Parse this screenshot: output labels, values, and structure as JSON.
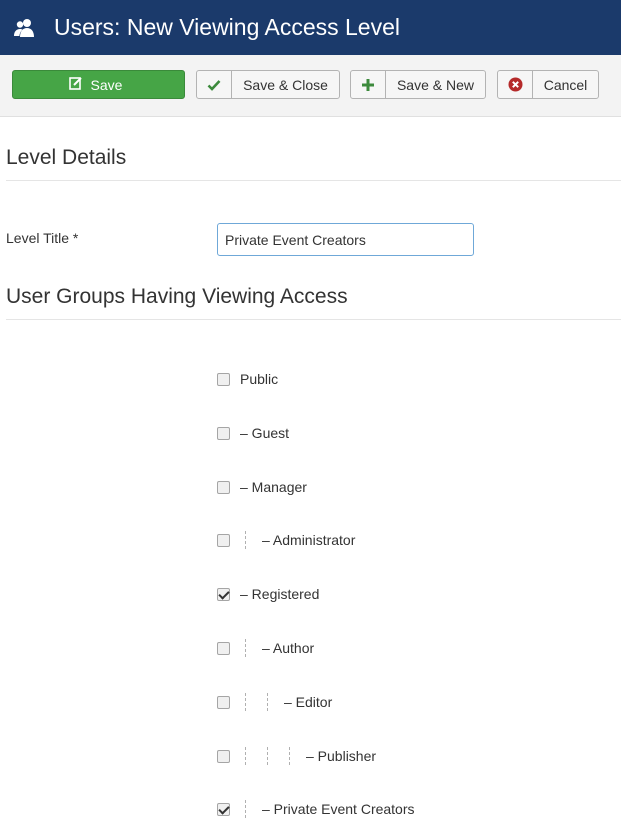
{
  "header": {
    "title": "Users: New Viewing Access Level",
    "icon": "users-icon"
  },
  "toolbar": {
    "save": {
      "label": "Save",
      "icon": "edit-icon"
    },
    "save_close": {
      "label": "Save & Close",
      "icon": "check-icon"
    },
    "save_new": {
      "label": "Save & New",
      "icon": "plus-icon"
    },
    "cancel": {
      "label": "Cancel",
      "icon": "cancel-circle-icon"
    }
  },
  "details": {
    "heading": "Level Details",
    "level_title_label": "Level Title *",
    "level_title_value": "Private Event Creators"
  },
  "groups": {
    "heading": "User Groups Having Viewing Access",
    "items": [
      {
        "label": "Public",
        "level": 0,
        "checked": false
      },
      {
        "label": "– Guest",
        "level": 0,
        "checked": false
      },
      {
        "label": "– Manager",
        "level": 0,
        "checked": false
      },
      {
        "label": "– Administrator",
        "level": 1,
        "checked": false
      },
      {
        "label": "– Registered",
        "level": 0,
        "checked": true
      },
      {
        "label": "– Author",
        "level": 1,
        "checked": false
      },
      {
        "label": "– Editor",
        "level": 2,
        "checked": false
      },
      {
        "label": "– Publisher",
        "level": 3,
        "checked": false
      },
      {
        "label": "– Private Event Creators",
        "level": 1,
        "checked": true
      }
    ]
  },
  "colors": {
    "header_bg": "#1b3a6b",
    "save_green": "#46a546",
    "check_green": "#3c8a3c",
    "cancel_red": "#b52a2a"
  }
}
